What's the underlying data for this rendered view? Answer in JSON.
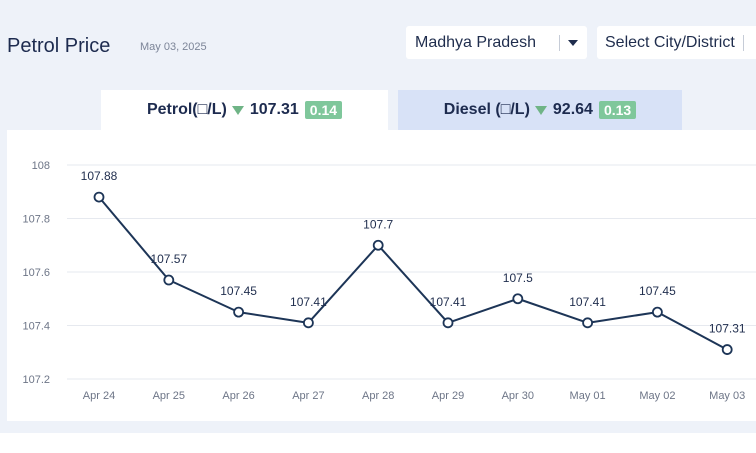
{
  "header": {
    "title": "Petrol Price",
    "date": "May 03, 2025",
    "state_select": "Madhya Pradesh",
    "city_select": "Select City/District"
  },
  "tabs": {
    "petrol": {
      "label": "Petrol(□/L)",
      "price": "107.31",
      "change": "0.14"
    },
    "diesel": {
      "label": "Diesel (□/L)",
      "price": "92.64",
      "change": "0.13"
    }
  },
  "colors": {
    "line": "#1d3557",
    "down_arrow": "#6fb486",
    "badge": "#7fc79b"
  },
  "chart_data": {
    "type": "line",
    "categories": [
      "Apr 24",
      "Apr 25",
      "Apr 26",
      "Apr 27",
      "Apr 28",
      "Apr 29",
      "Apr 30",
      "May 01",
      "May 02",
      "May 03"
    ],
    "series": [
      {
        "values": [
          107.88,
          107.57,
          107.45,
          107.41,
          107.7,
          107.41,
          107.5,
          107.41,
          107.45,
          107.31
        ]
      }
    ],
    "data_labels": [
      "107.88",
      "107.57",
      "107.45",
      "107.41",
      "107.7",
      "107.41",
      "107.5",
      "107.41",
      "107.45",
      "107.31"
    ],
    "yticks": [
      "107.2",
      "107.4",
      "107.6",
      "107.8",
      "108"
    ],
    "ylim": [
      107.2,
      108
    ],
    "grid": true
  }
}
